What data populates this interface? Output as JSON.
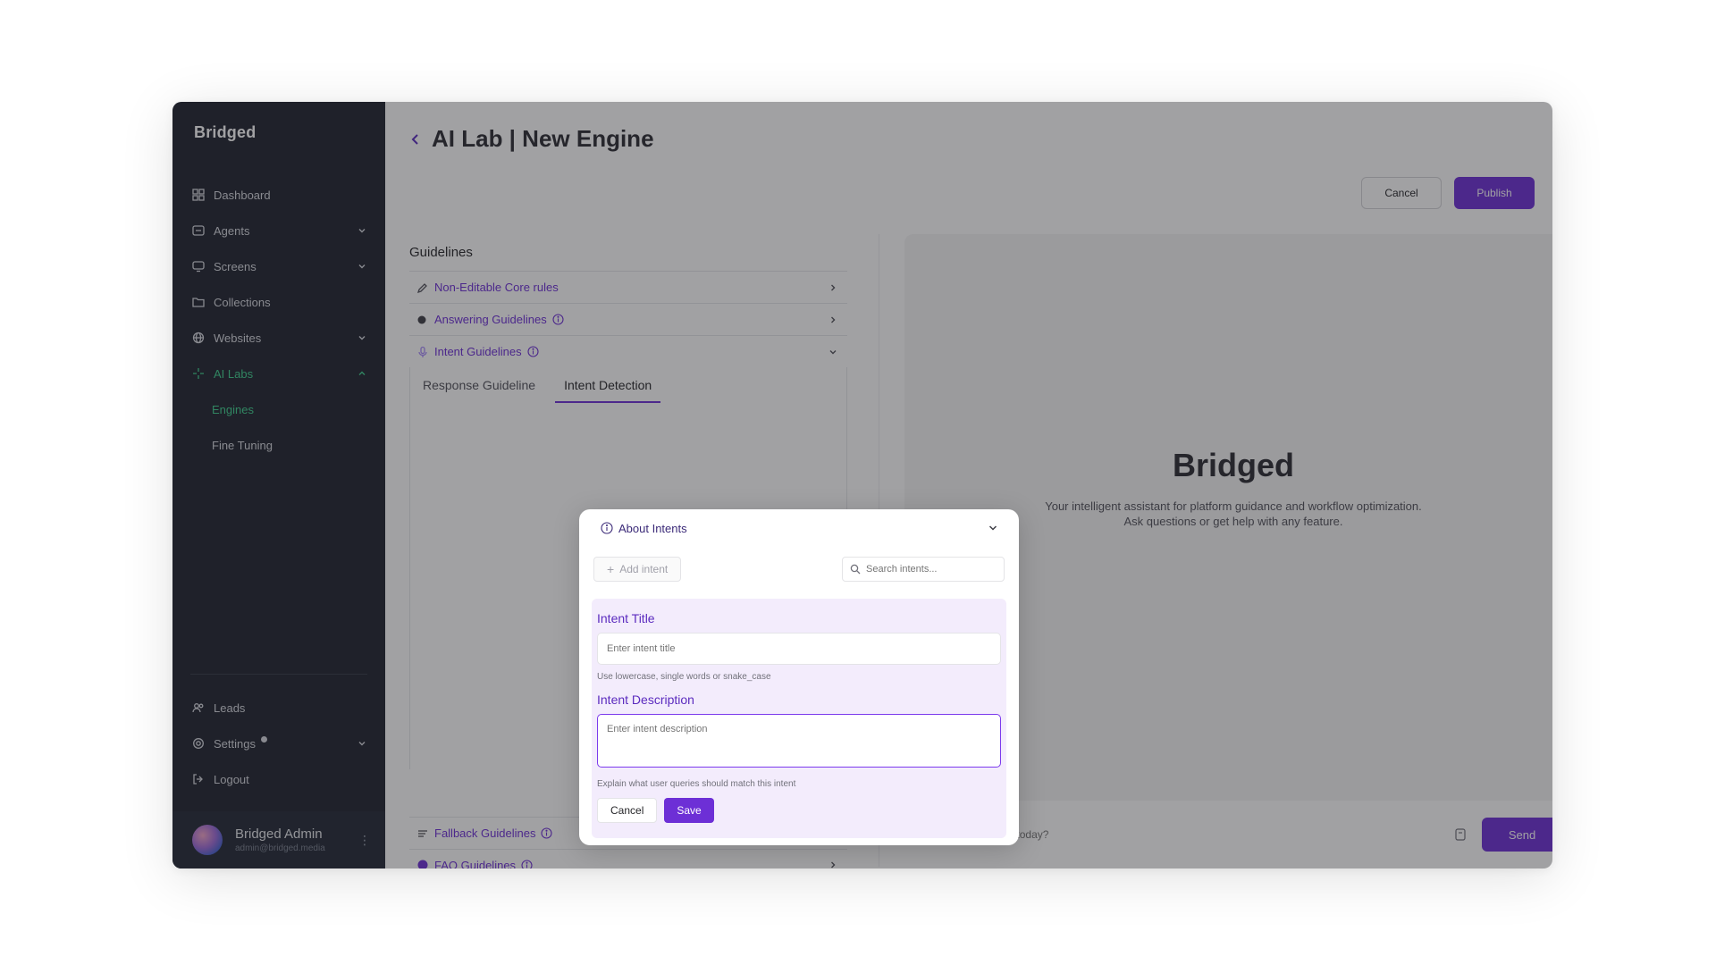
{
  "sidebar": {
    "brand": "Bridged",
    "nav": [
      {
        "label": "Dashboard"
      },
      {
        "label": "Agents"
      },
      {
        "label": "Screens"
      },
      {
        "label": "Collections"
      },
      {
        "label": "Websites"
      },
      {
        "label": "AI Labs"
      }
    ],
    "sub_items": [
      {
        "label": "Engines"
      },
      {
        "label": "Fine Tuning"
      }
    ],
    "bottom": [
      {
        "label": "Leads"
      },
      {
        "label": "Settings"
      },
      {
        "label": "Logout"
      }
    ],
    "user": {
      "name": "Bridged Admin",
      "email": "admin@bridged.media"
    }
  },
  "header": {
    "title": "AI Lab | New Engine",
    "cancel_label": "Cancel",
    "publish_label": "Publish"
  },
  "guidelines": {
    "title": "Guidelines",
    "rows": [
      {
        "label": "Non-Editable Core rules"
      },
      {
        "label": "Answering Guidelines"
      },
      {
        "label": "Intent Guidelines"
      }
    ],
    "tabs": [
      {
        "label": "Response Guideline"
      },
      {
        "label": "Intent Detection"
      }
    ],
    "bottom_rows": [
      {
        "label": "Fallback Guidelines"
      },
      {
        "label": "FAQ Guidelines"
      }
    ]
  },
  "intents": {
    "about_label": "About Intents",
    "add_label": "Add intent",
    "search_placeholder": "Search intents...",
    "title_label": "Intent Title",
    "title_placeholder": "Enter intent title",
    "title_hint": "Use lowercase, single words or snake_case",
    "desc_label": "Intent Description",
    "desc_placeholder": "Enter intent description",
    "desc_hint": "Explain what user queries should match this intent",
    "cancel_label": "Cancel",
    "save_label": "Save"
  },
  "preview": {
    "brand": "Bridged",
    "tagline_1": "Your intelligent assistant for platform guidance and workflow optimization.",
    "tagline_2": "Ask questions or get help with any feature.",
    "chat_placeholder": "How can I help you today?",
    "send_label": "Send"
  },
  "colors": {
    "accent": "#6d2fd6",
    "sidebar_bg": "#1f2430",
    "active_nav": "#3ecf8e"
  }
}
